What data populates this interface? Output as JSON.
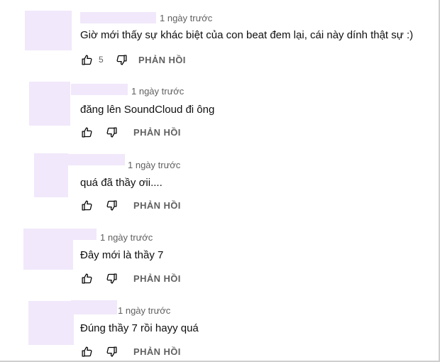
{
  "comments": [
    {
      "timestamp": "1 ngày trước",
      "text": "Giờ mới thấy sự khác biệt của con beat đem lại, cái này dính thật sự :)",
      "like_count": "5",
      "reply_label": "PHẢN HỒI"
    },
    {
      "timestamp": "1 ngày trước",
      "text": "đăng lên SoundCloud đi ông",
      "like_count": "",
      "reply_label": "PHẢN HỒI"
    },
    {
      "timestamp": "1 ngày trước",
      "text": "quá đã thầy ơii....",
      "like_count": "",
      "reply_label": "PHẢN HỒI"
    },
    {
      "timestamp": "1 ngày trước",
      "text": "Đây mới là thầy 7",
      "like_count": "",
      "reply_label": "PHẢN HỒI"
    },
    {
      "timestamp": "1 ngày trước",
      "text": "Đúng thầy 7 rồi hayy quá",
      "like_count": "",
      "reply_label": "PHẢN HỒI"
    }
  ],
  "icons": {
    "like": "thumbs-up-outline",
    "dislike": "thumbs-down-outline"
  },
  "colors": {
    "redaction": "#f1e8fb",
    "text": "#0f0f0f",
    "secondary": "#606060"
  }
}
